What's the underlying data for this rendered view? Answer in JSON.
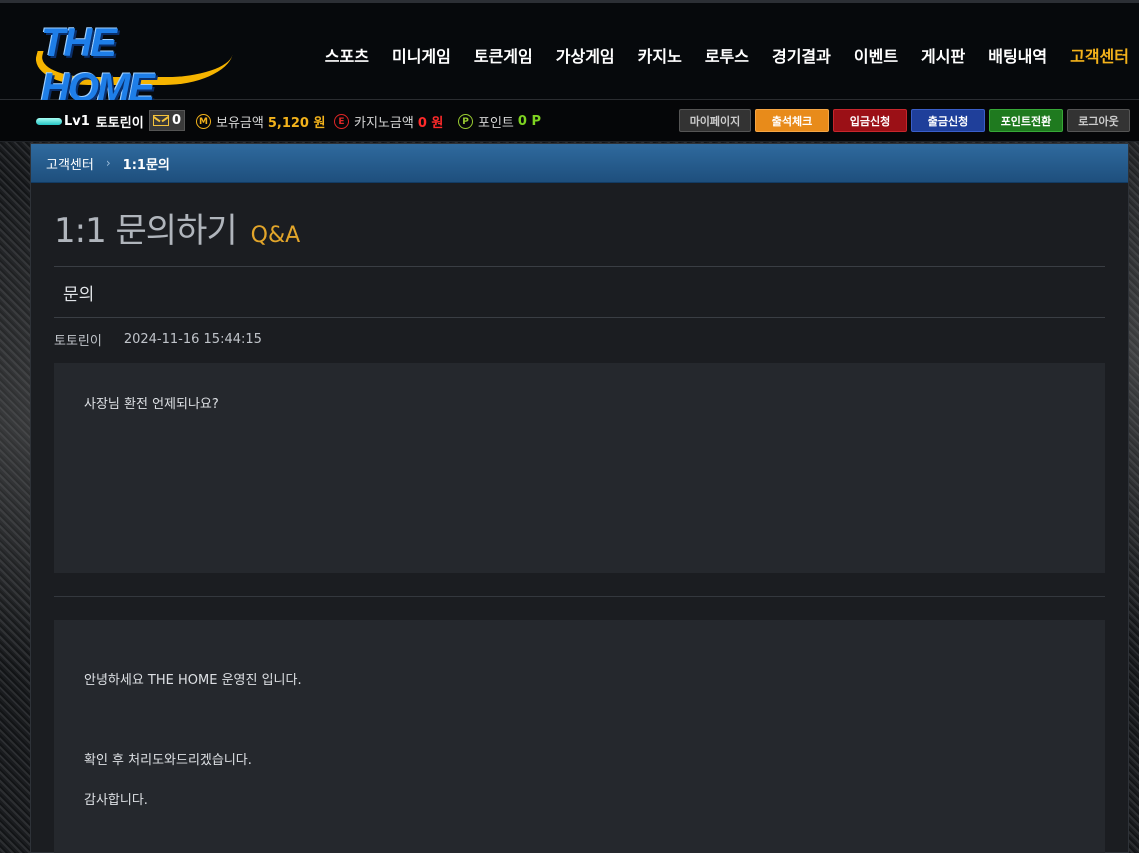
{
  "brand": {
    "logo_text": "THE HOME"
  },
  "nav": [
    "스포츠",
    "미니게임",
    "토큰게임",
    "가상게임",
    "카지노",
    "로투스",
    "경기결과",
    "이벤트",
    "게시판",
    "배팅내역",
    "고객센터"
  ],
  "user": {
    "level": "Lv1",
    "name": "토토린이",
    "messages": "0",
    "balance_label": "보유금액",
    "balance_value": "5,120 원",
    "casino_label": "카지노금액",
    "casino_value": "0 원",
    "point_label": "포인트",
    "point_value": "0 P",
    "coin_m": "M",
    "coin_e": "E",
    "coin_p": "P"
  },
  "actions": {
    "mypage": "마이페이지",
    "attendance": "출석체크",
    "deposit": "입금신청",
    "withdraw": "출금신청",
    "point_convert": "포인트전환",
    "logout": "로그아웃"
  },
  "breadcrumb": {
    "root": "고객센터",
    "sep": "›",
    "current": "1:1문의"
  },
  "page": {
    "title": "1:1 문의하기",
    "subtitle": "Q&A"
  },
  "inquiry": {
    "subject": "문의",
    "author": "토토린이",
    "date": "2024-11-16 15:44:15",
    "body": "사장님 환전 언제되나요?"
  },
  "reply": {
    "line1": "안녕하세요 THE HOME 운영진 입니다.",
    "line2": "확인 후 처리도와드리겠습니다.",
    "line3": "감사합니다."
  },
  "colors": {
    "accent": "#f3b21b",
    "breadcrumb": "#2f6a9e",
    "brand_blue": "#1e7ee8"
  }
}
